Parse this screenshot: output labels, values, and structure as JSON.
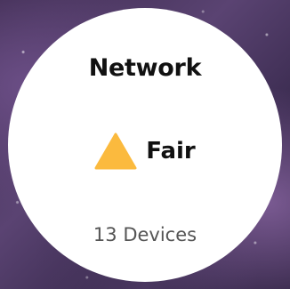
{
  "widget": {
    "title": "Network",
    "status": {
      "icon": "warning-triangle-icon",
      "icon_color": "#FBBA3E",
      "label": "Fair"
    },
    "devices_label": "13 Devices"
  },
  "colors": {
    "card_background": "#FFFFFF",
    "text_primary": "#111111",
    "text_secondary": "#555555"
  }
}
